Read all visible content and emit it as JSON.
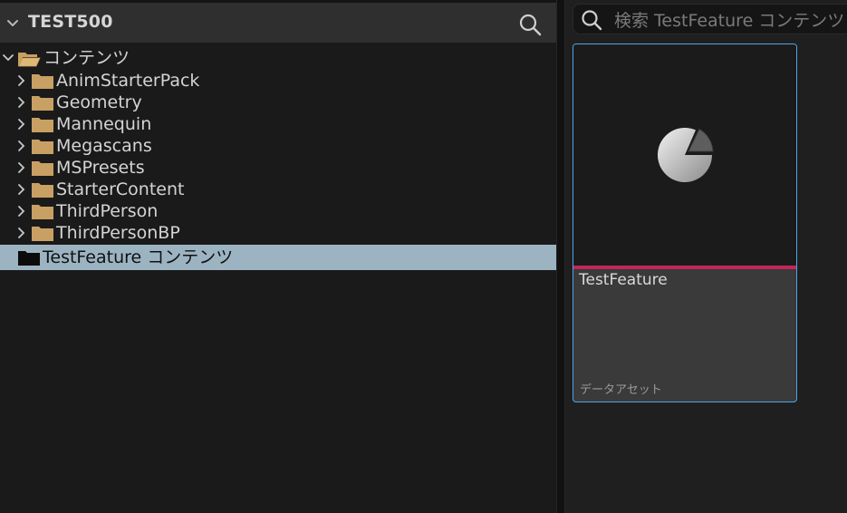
{
  "header": {
    "title": "TEST500",
    "search_icon": "search-icon",
    "collapse_icon": "chevron-down-icon"
  },
  "tree": {
    "root": {
      "label": "コンテンツ",
      "icon": "folder-open-icon",
      "expanded": true
    },
    "children": [
      {
        "label": "AnimStarterPack"
      },
      {
        "label": "Geometry"
      },
      {
        "label": "Mannequin"
      },
      {
        "label": "Megascans"
      },
      {
        "label": "MSPresets"
      },
      {
        "label": "StarterContent"
      },
      {
        "label": "ThirdPerson"
      },
      {
        "label": "ThirdPersonBP"
      }
    ],
    "selected": {
      "label": "TestFeature コンテンツ",
      "icon": "folder-icon"
    }
  },
  "right": {
    "search_placeholder": "検索 TestFeature コンテンツ",
    "asset": {
      "name": "TestFeature",
      "type": "データアセット",
      "type_color": "#c2265a",
      "icon": "data-asset-pie-icon"
    }
  },
  "colors": {
    "folder": "#c9a063",
    "selection": "#9cb4c2",
    "card_border": "#4aa6e8"
  }
}
